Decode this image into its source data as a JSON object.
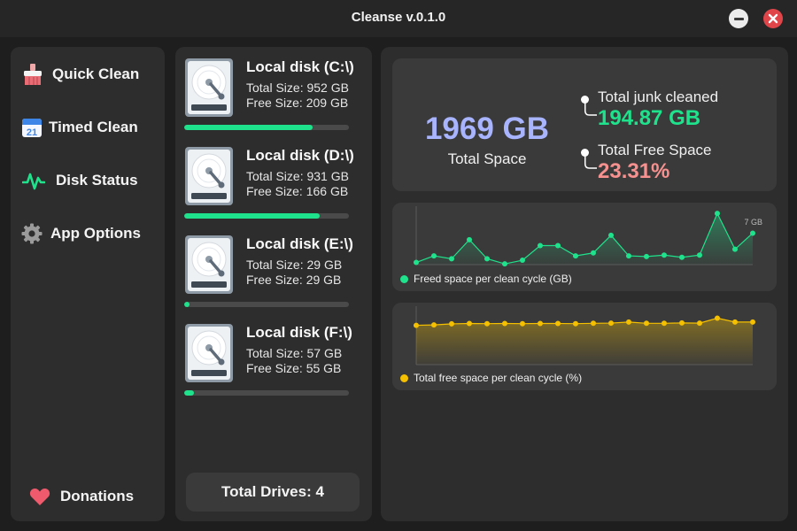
{
  "window": {
    "title": "Cleanse v.0.1.0"
  },
  "sidebar": {
    "items": [
      {
        "label": "Quick Clean",
        "icon": "broom-icon"
      },
      {
        "label": "Timed Clean",
        "icon": "calendar-icon",
        "icon_text": "21"
      },
      {
        "label": "Disk Status",
        "icon": "pulse-icon"
      },
      {
        "label": "App Options",
        "icon": "gear-icon"
      }
    ],
    "donations": {
      "label": "Donations",
      "icon": "heart-icon"
    }
  },
  "disks": [
    {
      "name": "Local disk (C:\\)",
      "total": "Total Size: 952 GB",
      "free": "Free Size: 209 GB",
      "used_fraction": 0.78
    },
    {
      "name": "Local disk (D:\\)",
      "total": "Total Size: 931 GB",
      "free": "Free Size: 166 GB",
      "used_fraction": 0.82
    },
    {
      "name": "Local disk (E:\\)",
      "total": "Total Size: 29 GB",
      "free": "Free Size: 29 GB",
      "used_fraction": 0.03
    },
    {
      "name": "Local disk (F:\\)",
      "total": "Total Size: 57 GB",
      "free": "Free Size: 55 GB",
      "used_fraction": 0.06
    }
  ],
  "total_drives": "Total Drives: 4",
  "summary": {
    "total_space": "1969 GB",
    "total_space_label": "Total Space",
    "junk_label": "Total junk cleaned",
    "junk_value": "194.87 GB",
    "free_label": "Total Free Space",
    "free_value": "23.31%"
  },
  "colors": {
    "accent_green": "#1fe38c",
    "accent_blue": "#a9b4ff",
    "accent_pink": "#f6918f",
    "accent_yellow": "#f5c000",
    "close_red": "#e0454a"
  },
  "chart_data": [
    {
      "type": "area",
      "legend": "Freed space per clean cycle (GB)",
      "annotation": "7 GB",
      "color": "#1fe38c",
      "ylim": [
        0,
        7.5
      ],
      "values": [
        0.3,
        1.2,
        0.8,
        3.4,
        0.8,
        0.1,
        0.6,
        2.6,
        2.6,
        1.2,
        1.6,
        4.0,
        1.2,
        1.1,
        1.3,
        1.0,
        1.3,
        7.0,
        2.1,
        4.3
      ]
    },
    {
      "type": "area",
      "legend": "Total free space per clean cycle (%)",
      "color": "#f5c000",
      "ylim": [
        0,
        30
      ],
      "values": [
        21.5,
        21.7,
        22.3,
        22.5,
        22.4,
        22.5,
        22.4,
        22.5,
        22.5,
        22.4,
        22.6,
        22.7,
        23.3,
        22.6,
        22.6,
        22.8,
        22.7,
        25.4,
        23.3,
        23.3
      ]
    }
  ]
}
